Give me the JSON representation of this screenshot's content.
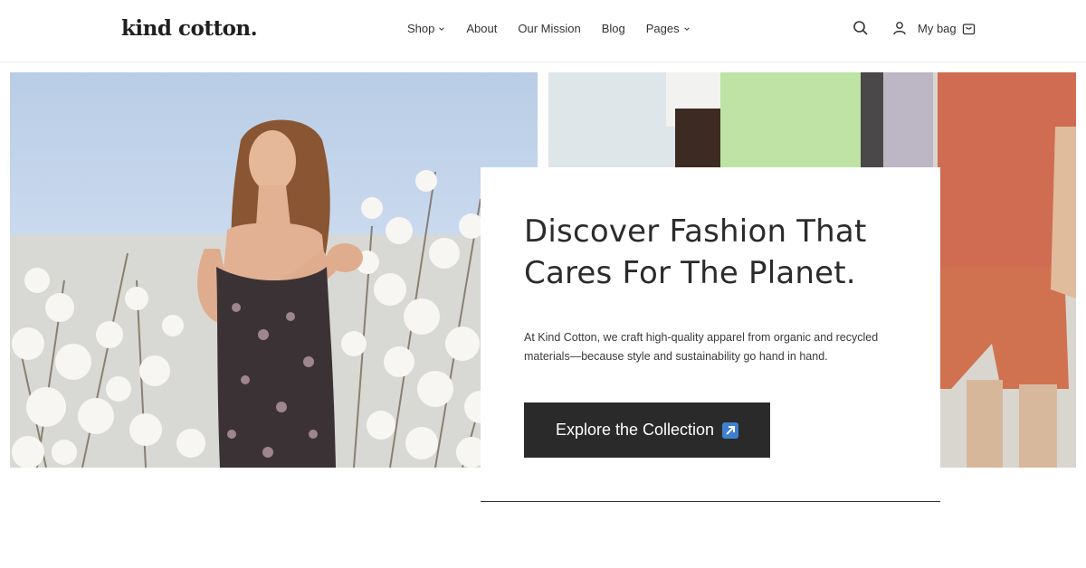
{
  "brand": {
    "logo_text": "kind cotton."
  },
  "nav": {
    "items": [
      {
        "label": "Shop",
        "dropdown": true
      },
      {
        "label": "About",
        "dropdown": false
      },
      {
        "label": "Our Mission",
        "dropdown": false
      },
      {
        "label": "Blog",
        "dropdown": false
      },
      {
        "label": "Pages",
        "dropdown": true
      }
    ]
  },
  "tools": {
    "search_icon": "search-icon",
    "account_icon": "user-icon",
    "bag_label": "My bag",
    "bag_icon": "shopping-bag-icon"
  },
  "hero": {
    "headline": "Discover Fashion That Cares For The Planet.",
    "description": "At Kind Cotton, we craft high-quality apparel from organic and recycled materials—because style and sustainability go hand in hand.",
    "cta_label": "Explore the Collection",
    "cta_icon": "arrow-up-right-icon"
  },
  "colors": {
    "cta_background": "#2a2a2a",
    "cta_icon": "#3e7fcf",
    "text": "#2b2b2b"
  }
}
